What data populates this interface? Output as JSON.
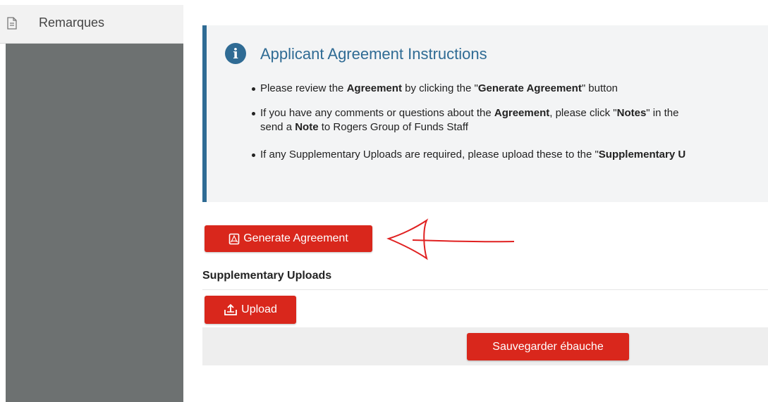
{
  "sidebar": {
    "item_label": "Remarques",
    "item_icon": "document-icon",
    "panel_color": "#6d7171"
  },
  "instructions": {
    "icon": "info-icon",
    "title": "Applicant Agreement Instructions",
    "accent_color": "#2f6b94",
    "items": [
      {
        "parts": [
          "Please review the ",
          "Agreement",
          " by clicking the \"",
          "Generate Agreement",
          "\" button"
        ]
      },
      {
        "line1_parts": [
          "If you have any comments or questions about the ",
          "Agreement",
          ", please click \"",
          "Notes",
          "\" in the"
        ],
        "line2_parts": [
          "send a ",
          "Note",
          " to Rogers Group of Funds Staff"
        ]
      },
      {
        "parts": [
          "If any Supplementary Uploads are required, please upload these to the \"",
          "Supplementary U"
        ]
      }
    ]
  },
  "actions": {
    "generate_label": "Generate Agreement",
    "generate_icon": "pdf-icon",
    "supplementary_title": "Supplementary Uploads",
    "upload_label": "Upload",
    "upload_icon": "upload-icon",
    "save_draft_label": "Sauvegarder ébauche",
    "button_color": "#d9271c"
  }
}
